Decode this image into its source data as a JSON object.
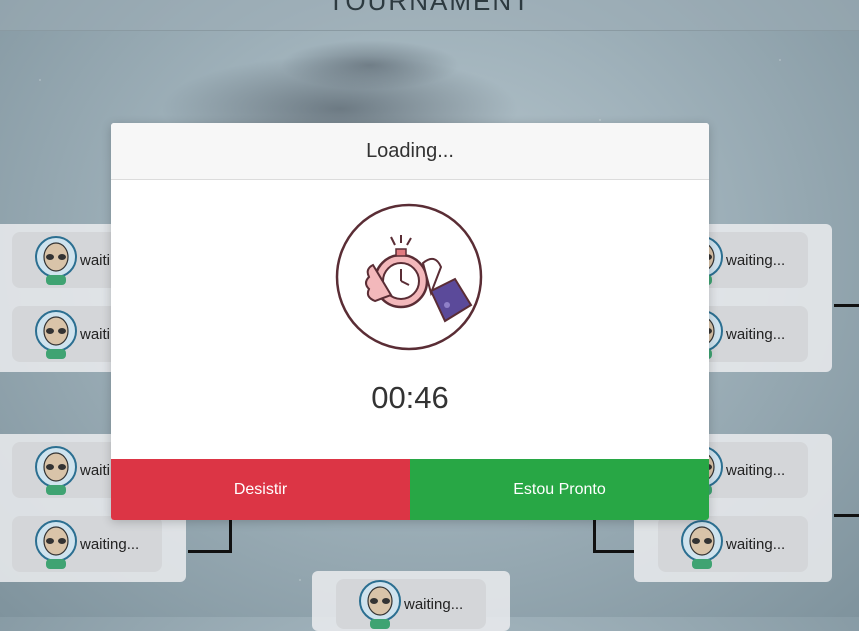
{
  "header": {
    "title": "TOURNAMENT"
  },
  "bracket": {
    "left_top": [
      "waiting...",
      "waiting..."
    ],
    "left_bottom": [
      "waiting...",
      "waiting..."
    ],
    "right_top": [
      "waiting...",
      "waiting..."
    ],
    "right_bottom": [
      "waiting...",
      "waiting..."
    ],
    "final": [
      "waiting..."
    ]
  },
  "modal": {
    "title": "Loading...",
    "icon": "stopwatch-hand-icon",
    "countdown": "00:46",
    "quit_label": "Desistir",
    "ready_label": "Estou Pronto"
  },
  "colors": {
    "quit": "#dc3545",
    "ready": "#28a745",
    "icon_outline": "#5a2d35",
    "icon_accent": "#e07a80",
    "icon_sleeve": "#5b4a9a"
  }
}
